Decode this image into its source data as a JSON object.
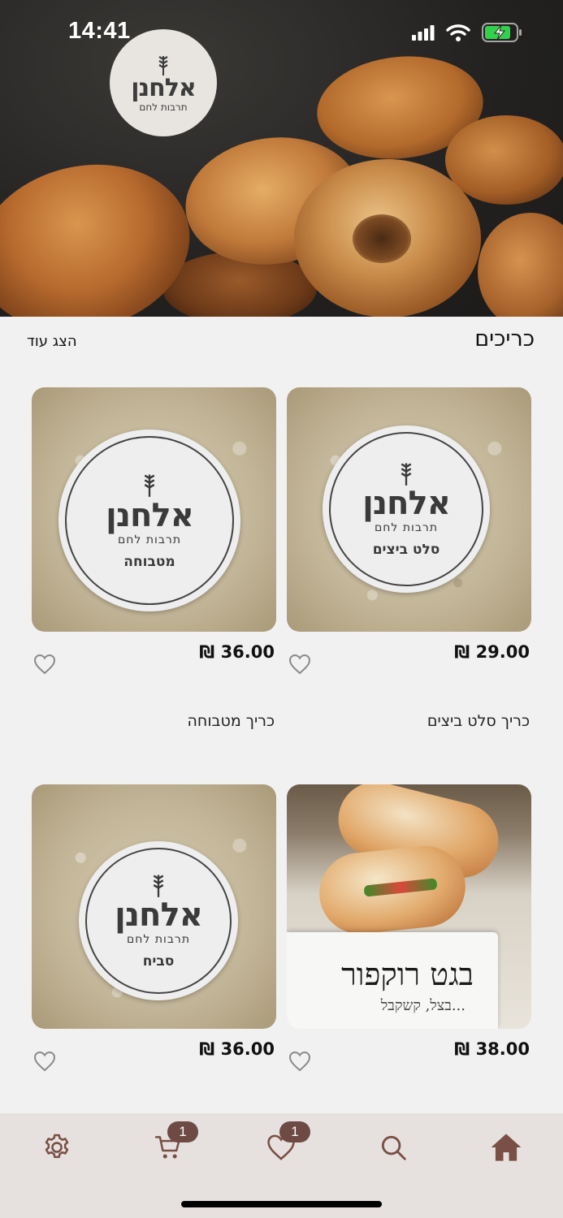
{
  "status_bar": {
    "time": "14:41"
  },
  "brand": {
    "name": "אלחנן",
    "tagline": "תרבות לחם"
  },
  "section": {
    "title": "כריכים",
    "show_more": "הצג עוד"
  },
  "products": [
    {
      "name": "כריך סלט ביצים",
      "price": "₪ 29.00",
      "sticker_label": "סלט ביצים",
      "image": "sticker-bread"
    },
    {
      "name": "כריך מטבוחה",
      "price": "₪ 36.00",
      "sticker_label": "מטבוחה",
      "image": "sticker-bread"
    },
    {
      "name": "",
      "price": "₪ 38.00",
      "sign_text": "בגט רוקפור",
      "sign_text2": "...בצל, קשקבל",
      "image": "baguette-photo"
    },
    {
      "name": "",
      "price": "₪ 36.00",
      "sticker_label": "סביח",
      "image": "sticker-bread"
    }
  ],
  "tab_bar": {
    "items": [
      {
        "icon": "gear-icon"
      },
      {
        "icon": "cart-icon",
        "badge": "1"
      },
      {
        "icon": "heart-icon",
        "badge": "1"
      },
      {
        "icon": "search-icon"
      },
      {
        "icon": "home-icon"
      }
    ]
  },
  "colors": {
    "accent": "#6e4a45",
    "tab_bar_bg": "#e6e1df",
    "background": "#f2f1f1"
  }
}
